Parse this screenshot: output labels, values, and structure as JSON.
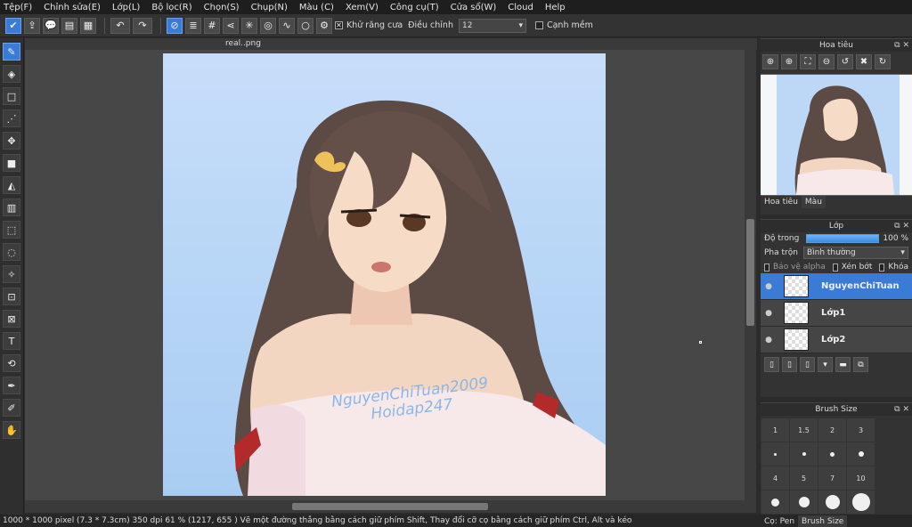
{
  "menu": [
    "Tệp(F)",
    "Chỉnh sửa(E)",
    "Lớp(L)",
    "Bộ lọc(R)",
    "Chọn(S)",
    "Chụp(N)",
    "Màu (C)",
    "Xem(V)",
    "Công cụ(T)",
    "Cửa sổ(W)",
    "Cloud",
    "Help"
  ],
  "toolbar": {
    "antialias_label": "Khử răng cưa",
    "adjust_label": "Điều chỉnh",
    "adjust_value": "12",
    "smooth_label": "Cạnh mềm"
  },
  "document": {
    "tab_name": "real..png",
    "watermark_line1": "NguyenChiTuan2009",
    "watermark_line2": "Hoidap247"
  },
  "status": {
    "text": "1000 * 1000 pixel  (7.3 * 7.3cm)  350 dpi  61 %  (1217, 655 )  Vẽ một đường thẳng bằng cách giữ phím Shift, Thay đổi cỡ cọ bằng cách giữ phím Ctrl, Alt và kéo"
  },
  "navigator": {
    "title": "Hoa tiêu",
    "tabs": [
      "Hoa tiêu",
      "Màu"
    ]
  },
  "layers": {
    "title": "Lớp",
    "opacity_label": "Độ trong",
    "opacity_value": "100 %",
    "opacity_fraction": 1.0,
    "blend_label": "Pha trộn",
    "blend_value": "Bình thường",
    "protect_alpha": "Bảo vệ alpha",
    "clip": "Xén bớt",
    "lock": "Khóa",
    "items": [
      {
        "name": "NguyenChiTuan",
        "selected": true
      },
      {
        "name": "Lớp1",
        "selected": false
      },
      {
        "name": "Lớp2",
        "selected": false
      }
    ]
  },
  "brush_size": {
    "title": "Brush Size",
    "sizes": [
      "1",
      "1.5",
      "2",
      "3",
      "4",
      "5",
      "7",
      "10",
      "",
      "",
      "",
      ""
    ],
    "tabs": [
      "Cọ: Pen",
      "Brush Size"
    ]
  },
  "colors": {
    "accent": "#3a7bd5",
    "sky": "#b9d6f7"
  }
}
